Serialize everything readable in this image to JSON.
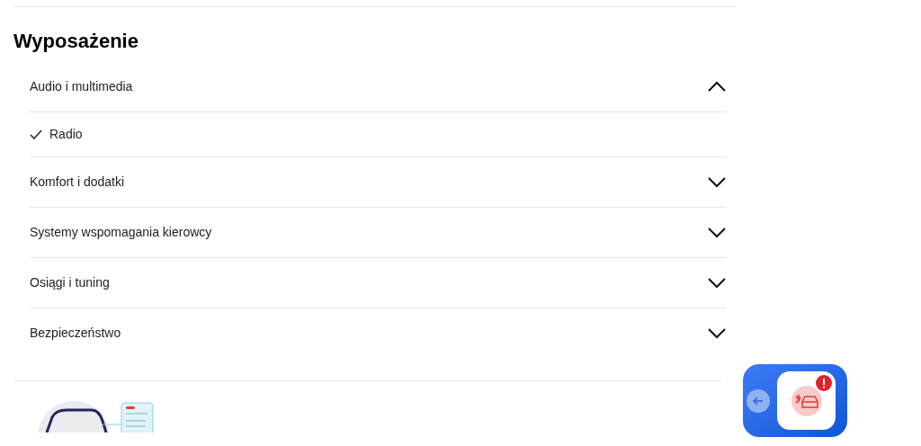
{
  "heading": "Wyposażenie",
  "sections": [
    {
      "title": "Audio i multimedia",
      "expanded": true,
      "items": [
        {
          "label": "Radio",
          "checked": true
        }
      ]
    },
    {
      "title": "Komfort i dodatki",
      "expanded": false
    },
    {
      "title": "Systemy wspomagania kierowcy",
      "expanded": false
    },
    {
      "title": "Osiągi i tuning",
      "expanded": false
    },
    {
      "title": "Bezpieczeństwo",
      "expanded": false
    }
  ]
}
